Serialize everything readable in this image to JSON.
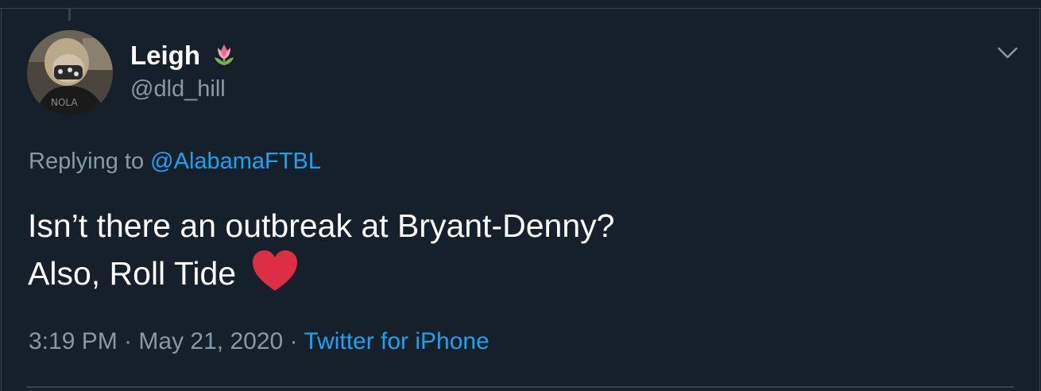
{
  "tweet": {
    "author": {
      "name": "Leigh",
      "handle": "@dld_hill",
      "name_emoji_icon": "tulip-icon"
    },
    "replying_prefix": "Replying to",
    "replying_to": "@AlabamaFTBL",
    "text_line1": "Isn’t there an outbreak at Bryant-Denny?",
    "text_line2": "Also, Roll Tide",
    "text_emoji_icon": "red-heart-icon",
    "time": "3:19 PM",
    "separator": "·",
    "date": "May 21, 2020",
    "source": "Twitter for iPhone",
    "menu_icon": "chevron-down-icon"
  },
  "colors": {
    "background": "#15202b",
    "text": "#ffffff",
    "secondary": "#8899a6",
    "link": "#1da1f2",
    "border": "#38444d",
    "heart": "#e0245e"
  }
}
